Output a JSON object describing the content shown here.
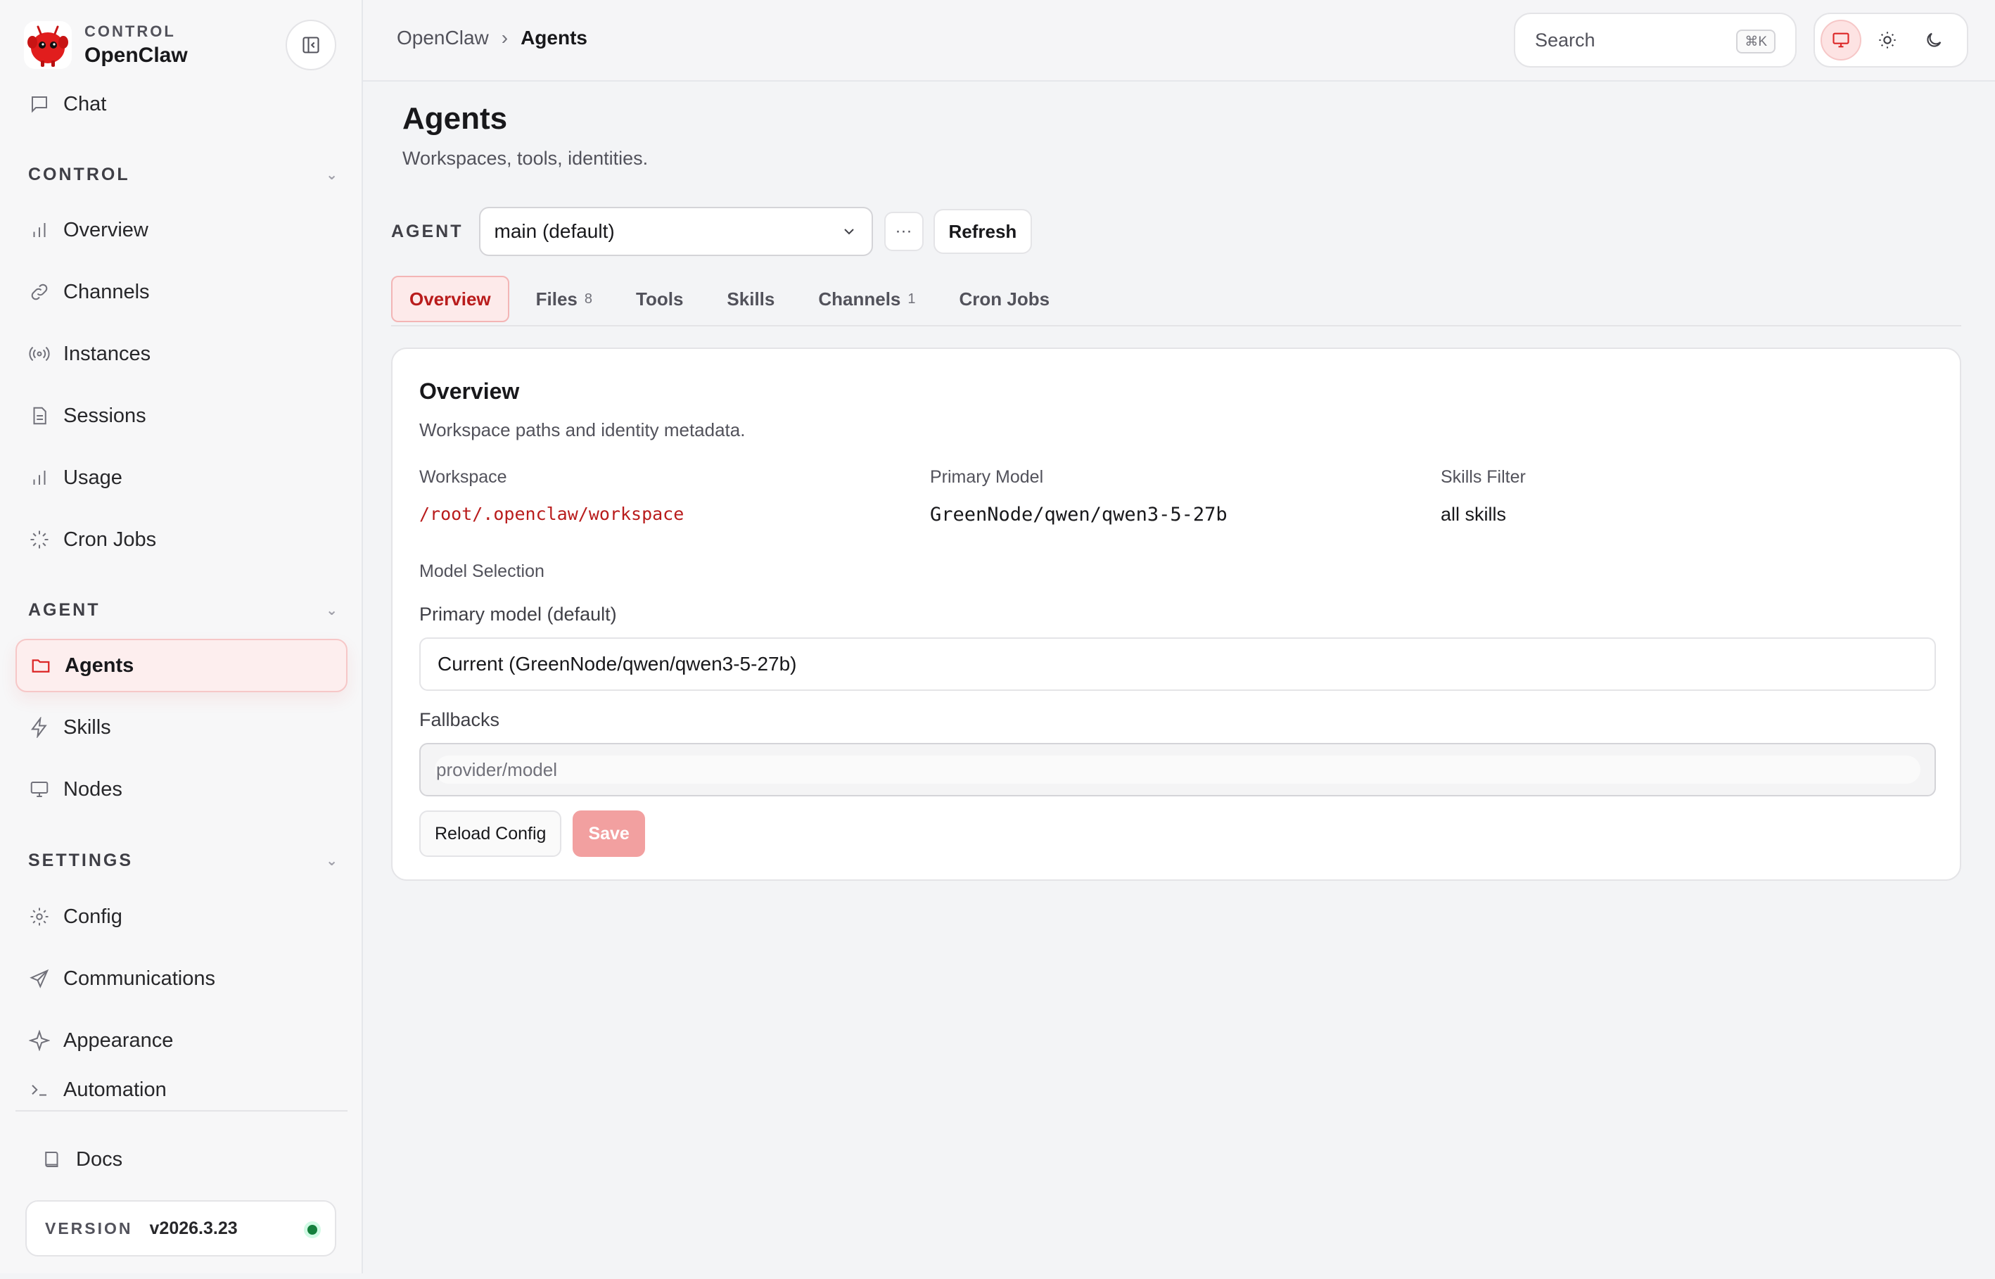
{
  "brand": {
    "sub": "CONTROL",
    "name": "OpenClaw"
  },
  "nav": {
    "chat": "Chat",
    "control_header": "CONTROL",
    "control_items": [
      "Overview",
      "Channels",
      "Instances",
      "Sessions",
      "Usage",
      "Cron Jobs"
    ],
    "agent_header": "AGENT",
    "agent_items": [
      "Agents",
      "Skills",
      "Nodes"
    ],
    "settings_header": "SETTINGS",
    "settings_items": [
      "Config",
      "Communications",
      "Appearance",
      "Automation"
    ],
    "docs": "Docs"
  },
  "version": {
    "label": "VERSION",
    "value": "v2026.3.23"
  },
  "topbar": {
    "crumbs": [
      "OpenClaw",
      "Agents"
    ],
    "crumb_sep": "›",
    "search_placeholder": "Search",
    "search_shortcut": "⌘K"
  },
  "page": {
    "title": "Agents",
    "subtitle": "Workspaces, tools, identities."
  },
  "agent_picker": {
    "label": "AGENT",
    "selected": "main (default)",
    "more": "···",
    "refresh": "Refresh"
  },
  "tabs": [
    {
      "label": "Overview",
      "count": ""
    },
    {
      "label": "Files",
      "count": "8"
    },
    {
      "label": "Tools",
      "count": ""
    },
    {
      "label": "Skills",
      "count": ""
    },
    {
      "label": "Channels",
      "count": "1"
    },
    {
      "label": "Cron Jobs",
      "count": ""
    }
  ],
  "overview": {
    "title": "Overview",
    "subtitle": "Workspace paths and identity metadata.",
    "workspace_label": "Workspace",
    "workspace_value": "/root/.openclaw/workspace",
    "primary_model_label": "Primary Model",
    "primary_model_value": "GreenNode/qwen/qwen3-5-27b",
    "skills_filter_label": "Skills Filter",
    "skills_filter_value": "all skills",
    "model_selection_label": "Model Selection",
    "primary_field_label": "Primary model (default)",
    "primary_field_value": "Current (GreenNode/qwen/qwen3-5-27b)",
    "fallbacks_label": "Fallbacks",
    "fallbacks_placeholder": "provider/model",
    "reload_button": "Reload Config",
    "save_button": "Save"
  },
  "colors": {
    "accent": "#dc2626",
    "accent_soft": "#fdeeee",
    "save_disabled": "#f2a0a0",
    "status_ok": "#15803d"
  },
  "icons": {
    "chat": "chat-icon",
    "overview": "bar-chart-icon",
    "channels": "link-icon",
    "instances": "radio-icon",
    "sessions": "document-icon",
    "usage": "bar-chart-icon",
    "cron": "loader-icon",
    "agents": "folder-icon",
    "skills": "bolt-icon",
    "nodes": "monitor-icon",
    "config": "gear-icon",
    "communications": "send-icon",
    "appearance": "sparkle-icon",
    "automation": "terminal-icon",
    "docs": "book-icon"
  }
}
